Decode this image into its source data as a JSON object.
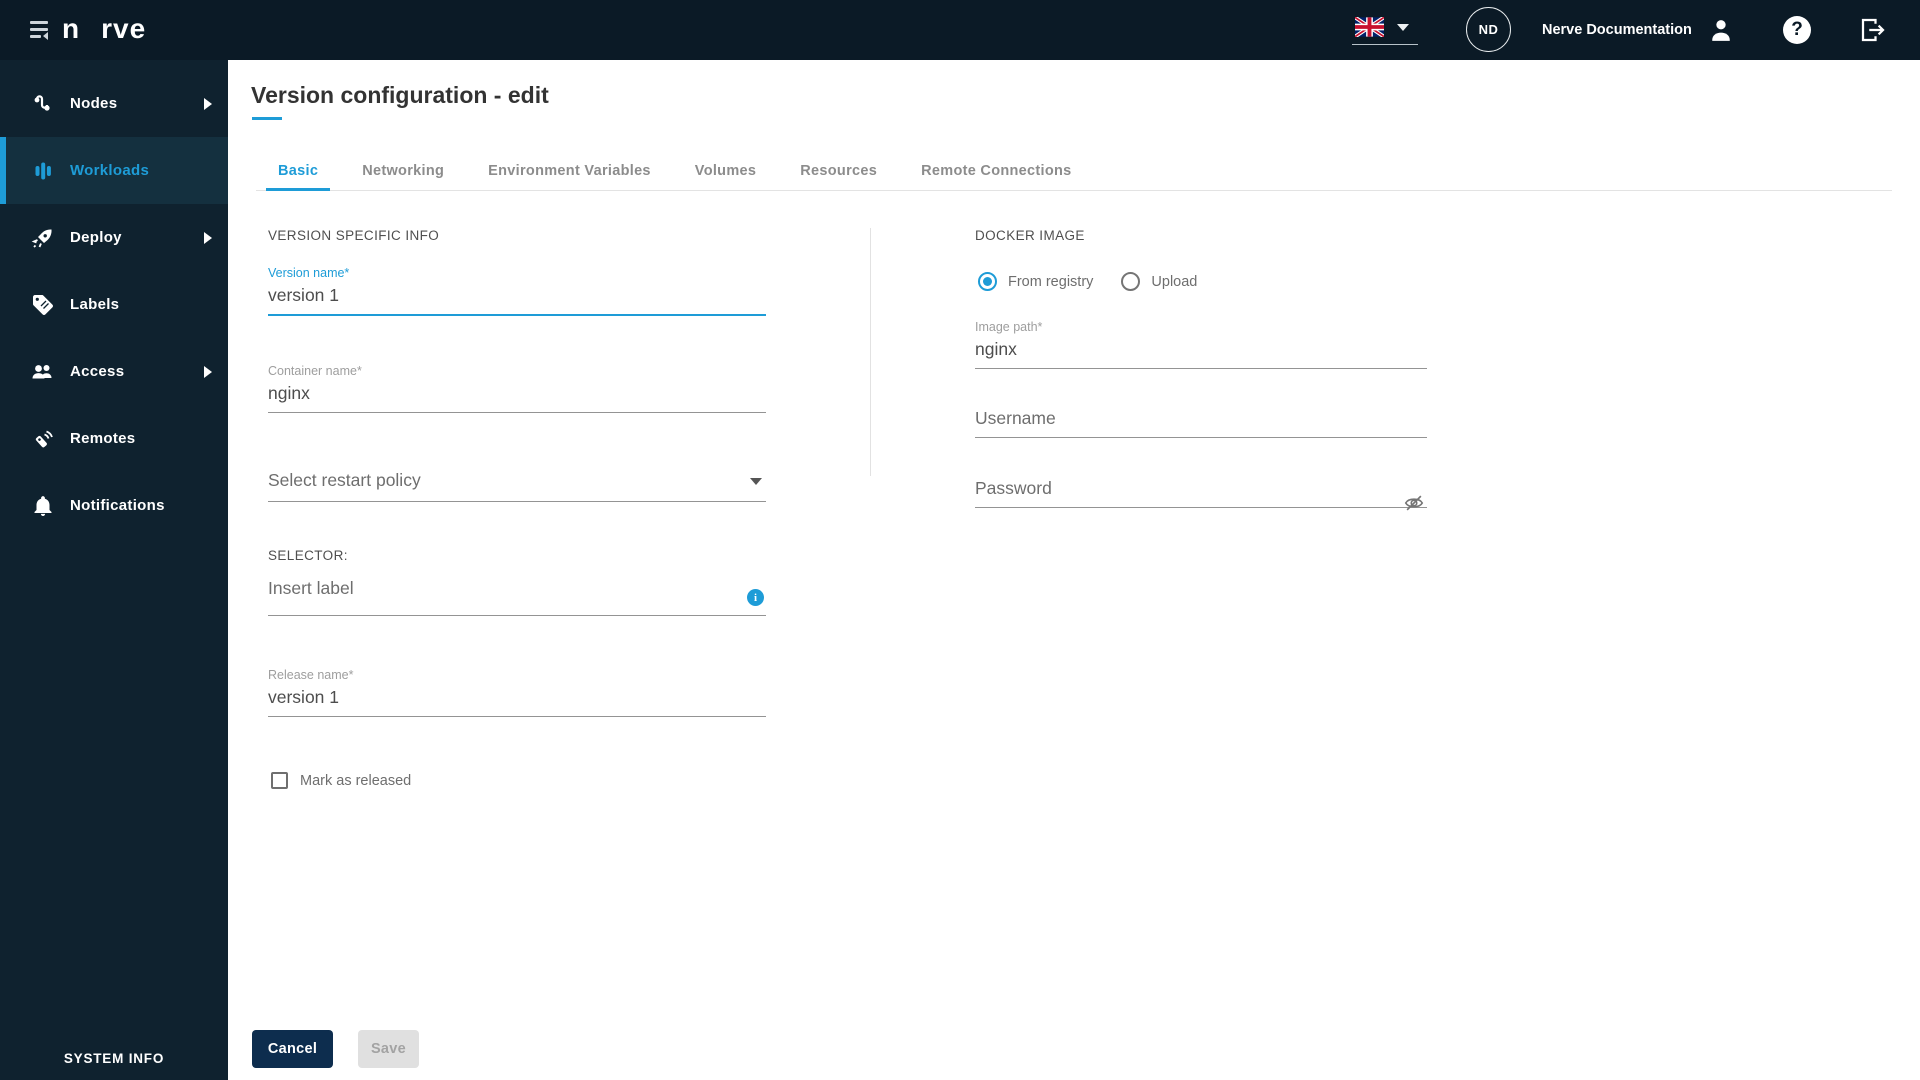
{
  "colors": {
    "accent": "#1e9cd7",
    "topbar_bg": "#0b1a26",
    "sidebar_bg": "#0f222f",
    "sidebar_active_bg": "#14303f",
    "cancel_button_bg": "#0d2d4e"
  },
  "topbar": {
    "logo_start": "n",
    "logo_end": "rve",
    "language_flag": "uk-flag",
    "avatar_initials": "ND",
    "docs_label": "Nerve Documentation"
  },
  "sidebar": {
    "items": [
      {
        "label": "Nodes",
        "icon": "nodes-icon",
        "has_submenu": true,
        "active": false
      },
      {
        "label": "Workloads",
        "icon": "workloads-icon",
        "has_submenu": false,
        "active": true
      },
      {
        "label": "Deploy",
        "icon": "deploy-icon",
        "has_submenu": true,
        "active": false
      },
      {
        "label": "Labels",
        "icon": "labels-icon",
        "has_submenu": false,
        "active": false
      },
      {
        "label": "Access",
        "icon": "access-icon",
        "has_submenu": true,
        "active": false
      },
      {
        "label": "Remotes",
        "icon": "remotes-icon",
        "has_submenu": false,
        "active": false
      },
      {
        "label": "Notifications",
        "icon": "notifications-icon",
        "has_submenu": false,
        "active": false
      }
    ],
    "footer_label": "SYSTEM INFO"
  },
  "page": {
    "title": "Version configuration - edit",
    "tabs": [
      {
        "label": "Basic",
        "active": true
      },
      {
        "label": "Networking",
        "active": false
      },
      {
        "label": "Environment Variables",
        "active": false
      },
      {
        "label": "Volumes",
        "active": false
      },
      {
        "label": "Resources",
        "active": false
      },
      {
        "label": "Remote Connections",
        "active": false
      }
    ]
  },
  "form": {
    "left": {
      "section_header": "VERSION SPECIFIC INFO",
      "version_name": {
        "label": "Version name*",
        "value": "version 1"
      },
      "container_name": {
        "label": "Container name*",
        "value": "nginx"
      },
      "restart_policy": {
        "placeholder": "Select restart policy"
      },
      "selector_header": "SELECTOR:",
      "selector": {
        "placeholder": "Insert label",
        "info": "i"
      },
      "release_name": {
        "label": "Release name*",
        "value": "version 1"
      },
      "mark_released": {
        "label": "Mark as released",
        "checked": false
      }
    },
    "right": {
      "section_header": "DOCKER IMAGE",
      "source_options": [
        {
          "label": "From registry",
          "selected": true
        },
        {
          "label": "Upload",
          "selected": false
        }
      ],
      "image_path": {
        "label": "Image path*",
        "value": "nginx"
      },
      "username": {
        "placeholder": "Username",
        "value": ""
      },
      "password": {
        "placeholder": "Password",
        "value": ""
      }
    },
    "actions": {
      "cancel_label": "Cancel",
      "save_label": "Save",
      "save_enabled": false
    }
  }
}
